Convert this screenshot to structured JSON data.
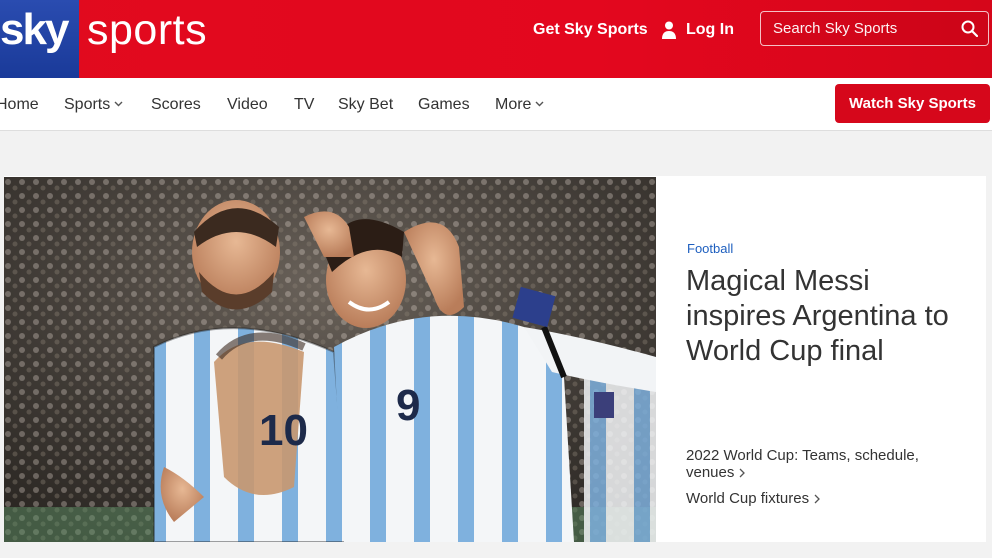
{
  "brand": {
    "sky": "sky",
    "sports": "sports",
    "colors": {
      "red": "#e10a1e",
      "blue": "#1a3a99",
      "link": "#1e5fbf"
    }
  },
  "header": {
    "get_sky_sports": "Get Sky Sports",
    "login": "Log In",
    "search_placeholder": "Search Sky Sports",
    "icons": [
      "user-icon",
      "search-icon"
    ]
  },
  "nav": {
    "items": [
      {
        "label": "Home"
      },
      {
        "label": "Sports",
        "dropdown": true
      },
      {
        "label": "Scores"
      },
      {
        "label": "Video"
      },
      {
        "label": "TV"
      },
      {
        "label": "Sky Bet"
      },
      {
        "label": "Games"
      },
      {
        "label": "More",
        "dropdown": true
      }
    ],
    "cta": "Watch Sky Sports"
  },
  "hero": {
    "category": "Football",
    "headline": "Magical Messi inspires Argentina to World Cup final",
    "related": [
      "2022 World Cup: Teams, schedule, venues",
      "World Cup fixtures"
    ],
    "image_shirt_numbers": [
      "10",
      "9"
    ]
  }
}
